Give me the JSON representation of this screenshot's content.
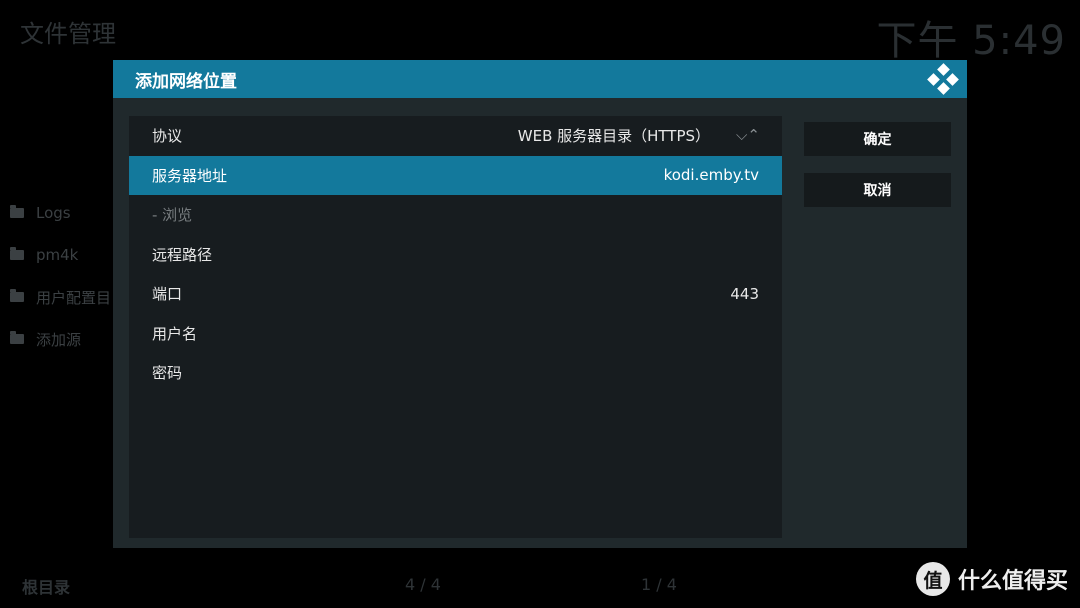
{
  "background": {
    "title": "文件管理",
    "clock": "下午 5:49",
    "items": [
      {
        "label": "Logs"
      },
      {
        "label": "pm4k"
      },
      {
        "label": "用户配置目"
      },
      {
        "label": "添加源"
      }
    ],
    "footer": {
      "root_label": "根目录",
      "page_left": "4 / 4",
      "page_right": "1 / 4"
    }
  },
  "dialog": {
    "title": "添加网络位置",
    "rows": [
      {
        "label": "协议",
        "value": "WEB 服务器目录（HTTPS）",
        "state": "normal",
        "has_spinner": true
      },
      {
        "label": "服务器地址",
        "value": "kodi.emby.tv",
        "state": "selected"
      },
      {
        "label": "- 浏览",
        "value": "",
        "state": "disabled"
      },
      {
        "label": "远程路径",
        "value": "",
        "state": "normal"
      },
      {
        "label": "端口",
        "value": "443",
        "state": "normal"
      },
      {
        "label": "用户名",
        "value": "",
        "state": "normal"
      },
      {
        "label": "密码",
        "value": "",
        "state": "normal"
      }
    ],
    "spinner": {
      "down": "⌵",
      "up": "⌃"
    },
    "ok_label": "确定",
    "cancel_label": "取消"
  },
  "watermark": {
    "badge": "值",
    "text": "什么值得买"
  },
  "colors": {
    "accent": "#13799c",
    "dialog_bg": "#20292c",
    "panel_bg": "#171c1f",
    "button_bg": "#151a1c"
  }
}
